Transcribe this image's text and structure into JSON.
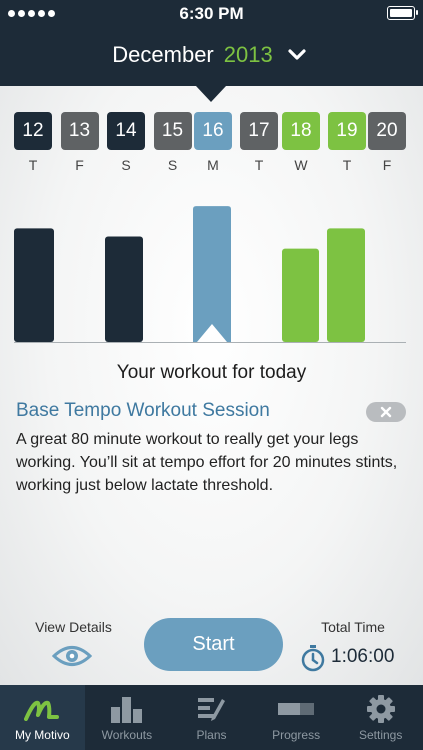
{
  "status_bar": {
    "time": "6:30 PM"
  },
  "header": {
    "month": "December",
    "year": "2013"
  },
  "calendar": {
    "days": [
      {
        "num": "12",
        "dow": "T",
        "status": "done"
      },
      {
        "num": "13",
        "dow": "F",
        "status": "rest"
      },
      {
        "num": "14",
        "dow": "S",
        "status": "done"
      },
      {
        "num": "15",
        "dow": "S",
        "status": "rest"
      },
      {
        "num": "16",
        "dow": "M",
        "status": "today"
      },
      {
        "num": "17",
        "dow": "T",
        "status": "rest"
      },
      {
        "num": "18",
        "dow": "W",
        "status": "upcoming"
      },
      {
        "num": "19",
        "dow": "T",
        "status": "upcoming"
      },
      {
        "num": "20",
        "dow": "F",
        "status": "rest"
      }
    ],
    "colors": {
      "done": "#1d2b38",
      "rest": "#5f6264",
      "today": "#6b9fbf",
      "upcoming": "#7dc242"
    }
  },
  "chart_data": {
    "type": "bar",
    "categories": [
      "12",
      "13",
      "14",
      "15",
      "16",
      "17",
      "18",
      "19",
      "20"
    ],
    "values": [
      112,
      0,
      104,
      0,
      134,
      0,
      92,
      112,
      0
    ],
    "ylim": [
      0,
      140
    ]
  },
  "workout": {
    "heading": "Your workout for today",
    "title": "Base Tempo Workout Session",
    "description": "A great 80 minute workout to really get your legs working. You’ll sit at tempo effort for 20 minutes stints, working just below lactate threshold."
  },
  "actions": {
    "view_details_label": "View Details",
    "start_label": "Start",
    "total_time_label": "Total Time",
    "total_time_value": "1:06:00"
  },
  "tabbar": {
    "tabs": [
      {
        "label": "My Motivo",
        "icon": "motivo-logo-icon",
        "active": true
      },
      {
        "label": "Workouts",
        "icon": "bar-chart-icon",
        "active": false
      },
      {
        "label": "Plans",
        "icon": "plans-pencil-icon",
        "active": false
      },
      {
        "label": "Progress",
        "icon": "progress-bar-icon",
        "active": false
      },
      {
        "label": "Settings",
        "icon": "gear-icon",
        "active": false
      }
    ]
  }
}
